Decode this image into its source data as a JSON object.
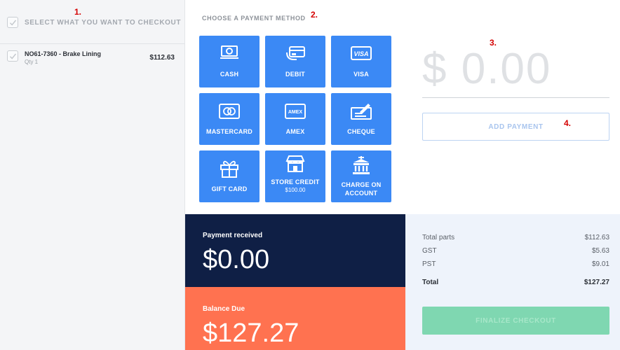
{
  "annotations": {
    "a1": "1.",
    "a2": "2.",
    "a3": "3.",
    "a4": "4."
  },
  "left": {
    "select_all_label": "SELECT WHAT YOU WANT TO CHECKOUT",
    "items": [
      {
        "name": "NO61-7360 - Brake Lining",
        "qty": "Qty 1",
        "price": "$112.63",
        "checked": true
      }
    ]
  },
  "payment": {
    "heading": "CHOOSE A PAYMENT METHOD",
    "methods": [
      {
        "label": "CASH",
        "icon": "cash-icon"
      },
      {
        "label": "DEBIT",
        "icon": "debit-card-icon"
      },
      {
        "label": "VISA",
        "icon": "visa-icon"
      },
      {
        "label": "MASTERCARD",
        "icon": "mastercard-icon"
      },
      {
        "label": "AMEX",
        "icon": "amex-icon"
      },
      {
        "label": "CHEQUE",
        "icon": "cheque-icon"
      },
      {
        "label": "GIFT CARD",
        "icon": "gift-icon"
      },
      {
        "label": "STORE CREDIT",
        "sub": "$100.00",
        "icon": "store-icon"
      },
      {
        "label": "CHARGE ON",
        "label2": "ACCOUNT",
        "icon": "bank-icon"
      }
    ],
    "amount": "$ 0.00",
    "add_button": "ADD PAYMENT"
  },
  "received": {
    "title": "Payment received",
    "value": "$0.00"
  },
  "due": {
    "title": "Balance Due",
    "value": "$127.27"
  },
  "summary": {
    "rows": [
      {
        "label": "Total parts",
        "value": "$112.63"
      },
      {
        "label": "GST",
        "value": "$5.63"
      },
      {
        "label": "PST",
        "value": "$9.01"
      }
    ],
    "total": {
      "label": "Total",
      "value": "$127.27"
    },
    "finalize_button": "FINALIZE CHECKOUT"
  },
  "colors": {
    "method_blue": "#3b89f5",
    "navy": "#0f1f45",
    "coral": "#ff7250",
    "finalize_green": "#7fd7b1",
    "annotation_red": "#d40000"
  }
}
